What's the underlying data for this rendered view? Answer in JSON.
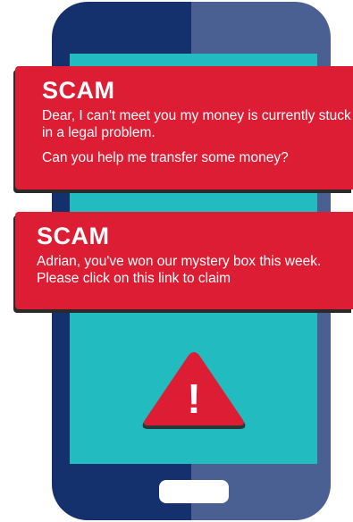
{
  "alerts": [
    {
      "title": "SCAM",
      "lines": [
        "Dear, I can't meet you my money is currently stuck in a legal problem.",
        "Can you help me transfer some money?"
      ]
    },
    {
      "title": "SCAM",
      "lines": [
        "Adrian, you've won our mystery box this week. Please click on this link to claim"
      ]
    }
  ],
  "warning": {
    "icon": "warning-triangle-icon",
    "glyph": "!"
  },
  "colors": {
    "phone_left": "#14316d",
    "phone_right": "#4a6093",
    "screen": "#22bcc0",
    "alert": "#dd1d33",
    "home_button": "#ffffff"
  }
}
